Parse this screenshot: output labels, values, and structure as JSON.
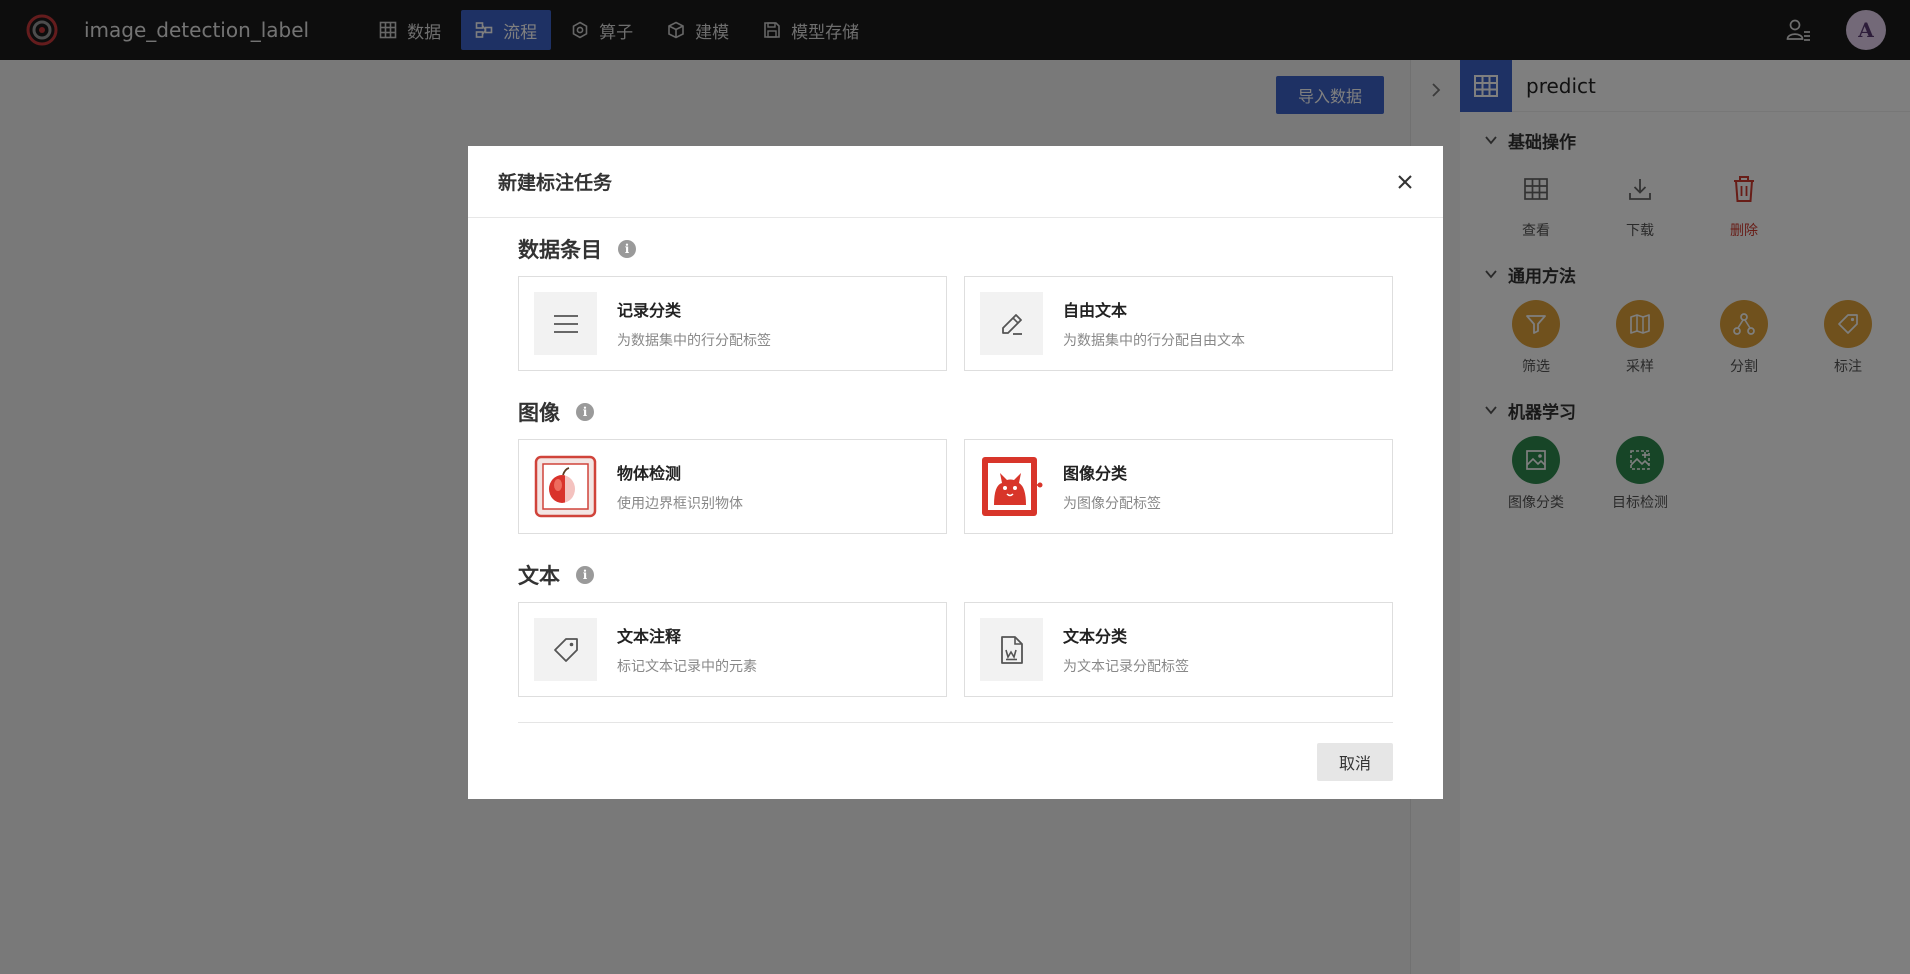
{
  "app": {
    "title": "image_detection_label",
    "avatar_letter": "A"
  },
  "nav": [
    {
      "label": "数据",
      "icon": "grid-icon"
    },
    {
      "label": "流程",
      "icon": "flow-icon",
      "active": true
    },
    {
      "label": "算子",
      "icon": "hexagon-icon"
    },
    {
      "label": "建模",
      "icon": "cube-icon"
    },
    {
      "label": "模型存储",
      "icon": "save-icon"
    }
  ],
  "main": {
    "import_label": "导入数据"
  },
  "right_panel": {
    "dataset_name": "predict",
    "sections": [
      {
        "title": "基础操作",
        "items": [
          {
            "label": "查看"
          },
          {
            "label": "下载"
          },
          {
            "label": "删除"
          }
        ]
      },
      {
        "title": "通用方法",
        "items": [
          {
            "label": "筛选"
          },
          {
            "label": "采样"
          },
          {
            "label": "分割"
          },
          {
            "label": "标注"
          }
        ]
      },
      {
        "title": "机器学习",
        "items": [
          {
            "label": "图像分类"
          },
          {
            "label": "目标检测"
          }
        ]
      }
    ]
  },
  "modal": {
    "title": "新建标注任务",
    "info_glyph": "i",
    "groups": [
      {
        "title": "数据条目",
        "cards": [
          {
            "title": "记录分类",
            "desc": "为数据集中的行分配标签"
          },
          {
            "title": "自由文本",
            "desc": "为数据集中的行分配自由文本"
          }
        ]
      },
      {
        "title": "图像",
        "cards": [
          {
            "title": "物体检测",
            "desc": "使用边界框识别物体"
          },
          {
            "title": "图像分类",
            "desc": "为图像分配标签"
          }
        ]
      },
      {
        "title": "文本",
        "cards": [
          {
            "title": "文本注释",
            "desc": "标记文本记录中的元素"
          },
          {
            "title": "文本分类",
            "desc": "为文本记录分配标签"
          }
        ]
      }
    ],
    "cancel_label": "取消"
  },
  "colors": {
    "accent": "#3c62c8",
    "topbar": "#1b1b1b",
    "gold": "#e0a33a",
    "green": "#2e8b4f",
    "danger": "#d03a2f"
  }
}
